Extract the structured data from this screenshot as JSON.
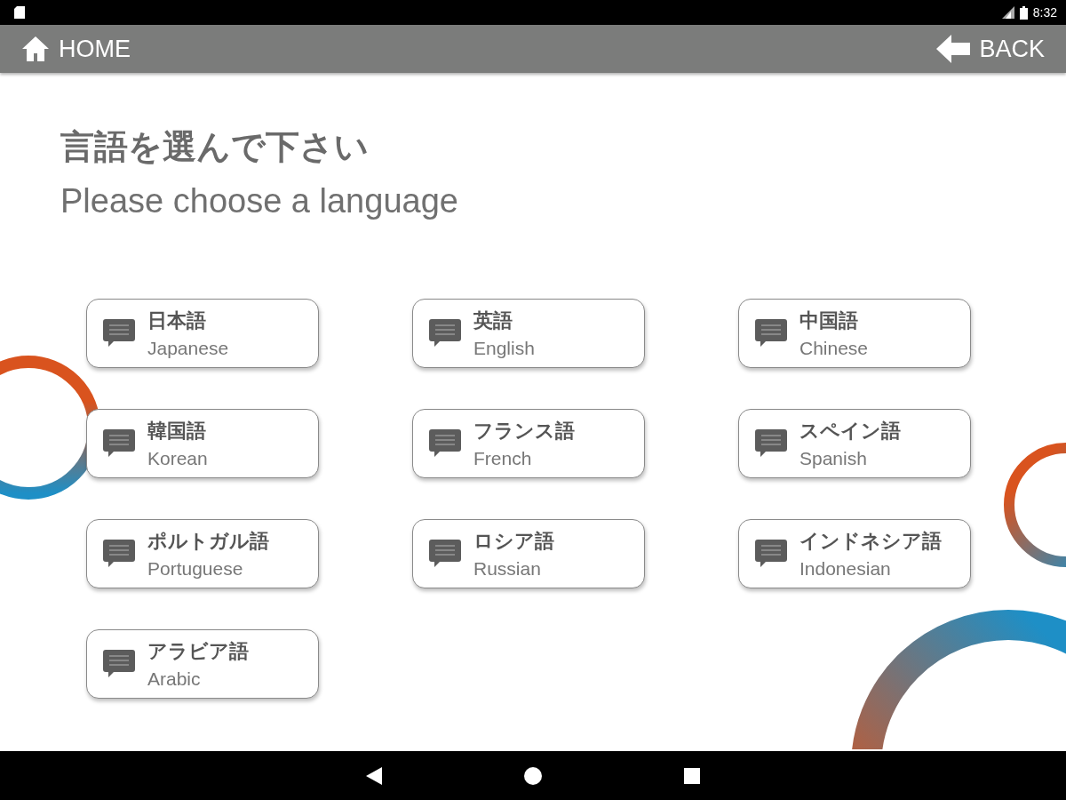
{
  "status_bar": {
    "time": "8:32"
  },
  "toolbar": {
    "home_label": "HOME",
    "back_label": "BACK"
  },
  "heading": {
    "title": "言語を選んで下さい",
    "subtitle": "Please choose a language"
  },
  "languages": [
    {
      "native": "日本語",
      "english": "Japanese"
    },
    {
      "native": "英語",
      "english": "English"
    },
    {
      "native": "中国語",
      "english": "Chinese"
    },
    {
      "native": "韓国語",
      "english": "Korean"
    },
    {
      "native": "フランス語",
      "english": "French"
    },
    {
      "native": "スペイン語",
      "english": "Spanish"
    },
    {
      "native": "ポルトガル語",
      "english": "Portuguese"
    },
    {
      "native": "ロシア語",
      "english": "Russian"
    },
    {
      "native": "インドネシア語",
      "english": "Indonesian"
    },
    {
      "native": "アラビア語",
      "english": "Arabic"
    }
  ]
}
